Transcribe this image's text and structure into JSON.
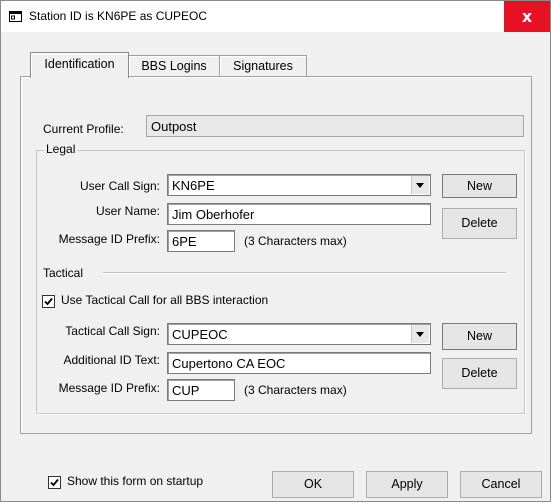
{
  "window": {
    "title": "Station ID is KN6PE as CUPEOC",
    "close_glyph": "x",
    "icon": "window-icon"
  },
  "tabs": [
    {
      "label": "Identification",
      "active": true
    },
    {
      "label": "BBS Logins",
      "active": false
    },
    {
      "label": "Signatures",
      "active": false
    }
  ],
  "profile": {
    "label": "Current Profile:",
    "value": "Outpost"
  },
  "legal": {
    "caption": "Legal",
    "call_sign_label": "User Call Sign:",
    "call_sign_value": "KN6PE",
    "user_name_label": "User Name:",
    "user_name_value": "Jim Oberhofer",
    "msg_prefix_label": "Message ID Prefix:",
    "msg_prefix_value": "6PE",
    "msg_prefix_hint": "(3 Characters max)",
    "new_label": "New",
    "delete_label": "Delete"
  },
  "tactical": {
    "caption": "Tactical",
    "use_tactical_label": "Use Tactical Call for all BBS interaction",
    "use_tactical_checked": true,
    "call_sign_label": "Tactical Call Sign:",
    "call_sign_value": "CUPEOC",
    "additional_label": "Additional ID Text:",
    "additional_value": "Cupertono CA  EOC",
    "msg_prefix_label": "Message ID Prefix:",
    "msg_prefix_value": "CUP",
    "msg_prefix_hint": "(3 Characters max)",
    "new_label": "New",
    "delete_label": "Delete"
  },
  "footer": {
    "show_on_startup_label": "Show this form on startup",
    "show_on_startup_checked": true,
    "ok_label": "OK",
    "apply_label": "Apply",
    "cancel_label": "Cancel"
  }
}
